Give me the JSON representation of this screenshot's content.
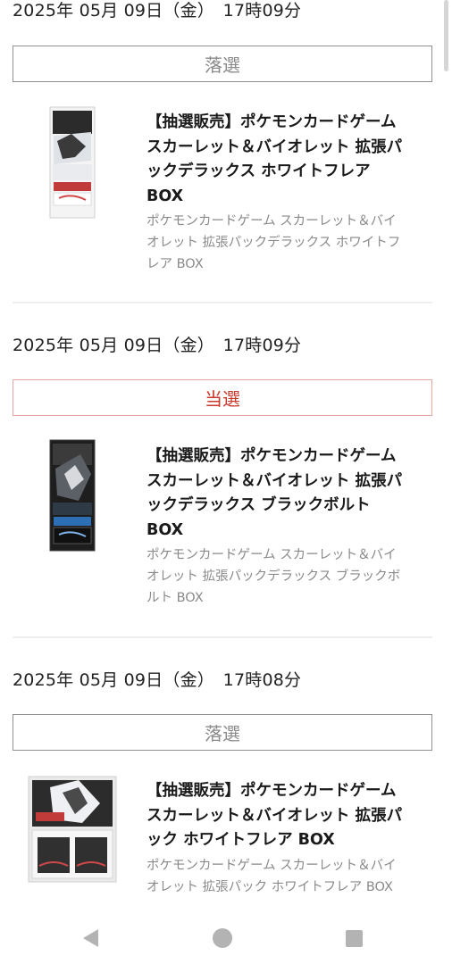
{
  "entries": [
    {
      "datetime": "2025年 05月 09日（金）　17時09分",
      "status": "落選",
      "status_type": "lost",
      "product_title": "【抽選販売】ポケモンカードゲーム スカーレット＆バイオレット 拡張パックデラックス ホワイトフレア BOX",
      "product_title_lines": [
        "【抽選販売】ポケモンカードゲーム",
        "スカーレット＆バイオレット 拡張パ",
        "ックデラックス ホワイトフレア",
        "BOX"
      ],
      "product_description": "ポケモンカードゲーム スカーレット＆バイオレット 拡張パックデラックス ホワイトフレア BOX",
      "product_description_lines": [
        "ポケモンカードゲーム スカーレット＆バイ",
        "オレット 拡張パックデラックス ホワイトフ",
        "レア BOX"
      ]
    },
    {
      "datetime": "2025年 05月 09日（金）　17時09分",
      "status": "当選",
      "status_type": "won",
      "product_title": "【抽選販売】ポケモンカードゲーム スカーレット＆バイオレット 拡張パックデラックス ブラックボルト BOX",
      "product_title_lines": [
        "【抽選販売】ポケモンカードゲーム",
        "スカーレット＆バイオレット 拡張パ",
        "ックデラックス ブラックボルト",
        "BOX"
      ],
      "product_description": "ポケモンカードゲーム スカーレット＆バイオレット 拡張パックデラックス ブラックボルト BOX",
      "product_description_lines": [
        "ポケモンカードゲーム スカーレット＆バイ",
        "オレット 拡張パックデラックス ブラックボ",
        "ルト BOX"
      ]
    },
    {
      "datetime": "2025年 05月 09日（金）　17時08分",
      "status": "落選",
      "status_type": "lost",
      "product_title": "【抽選販売】ポケモンカードゲーム スカーレット＆バイオレット 拡張パック ホワイトフレア BOX",
      "product_title_lines": [
        "【抽選販売】ポケモンカードゲーム",
        "スカーレット＆バイオレット 拡張パ",
        "ック ホワイトフレア BOX"
      ],
      "product_description": "ポケモンカードゲーム スカーレット＆バイオレット 拡張パック ホワイトフレア BOX",
      "product_description_lines": [
        "ポケモンカードゲーム スカーレット＆バイ",
        "オレット 拡張パック ホワイトフレア BOX"
      ]
    }
  ],
  "colors": {
    "lost_text": "#8a8a8a",
    "lost_border": "#8f8f8f",
    "won_text": "#c8392b",
    "won_border": "#e8a99f",
    "divider": "#eeeeee",
    "nav_icon": "#b3b3b3"
  },
  "navbar": {
    "back_icon": "triangle-back-icon",
    "home_icon": "circle-home-icon",
    "recent_icon": "square-recents-icon"
  }
}
